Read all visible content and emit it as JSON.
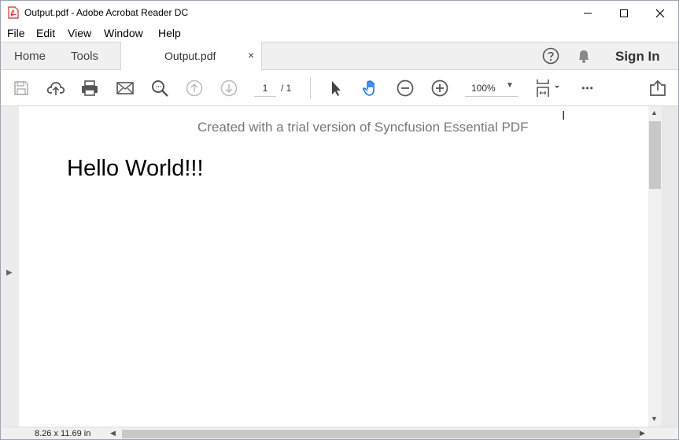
{
  "window": {
    "title": "Output.pdf - Adobe Acrobat Reader DC",
    "minimize_icon": "minimize-icon",
    "maximize_icon": "maximize-icon",
    "close_icon": "close-icon"
  },
  "menu": {
    "items": [
      "File",
      "Edit",
      "View",
      "Window",
      "Help"
    ]
  },
  "tabs": {
    "home": "Home",
    "tools": "Tools",
    "document": "Output.pdf",
    "close_glyph": "×",
    "sign_in": "Sign In"
  },
  "toolbar": {
    "page_current": "1",
    "page_total": "/ 1",
    "zoom": "100%",
    "zoom_caret": "▼",
    "more_glyph": "•••",
    "accent_color": "#1473e6",
    "icons": [
      "save-icon",
      "upload-cloud-icon",
      "print-icon",
      "email-icon",
      "search-zoom-icon",
      "prev-page-icon",
      "next-page-icon",
      "select-cursor-icon",
      "hand-tool-icon",
      "zoom-out-icon",
      "zoom-in-icon",
      "fit-page-icon",
      "more-icon",
      "share-icon"
    ]
  },
  "document": {
    "watermark": "Created with a trial version of Syncfusion Essential PDF",
    "body_text": "Hello World!!!",
    "expand_arrow": "▶",
    "cursor_glyph": "I"
  },
  "status": {
    "page_size": "8.26 x 11.69 in",
    "scroll_up": "▲",
    "scroll_down": "▼",
    "scroll_left": "◀",
    "scroll_right": "▶"
  }
}
